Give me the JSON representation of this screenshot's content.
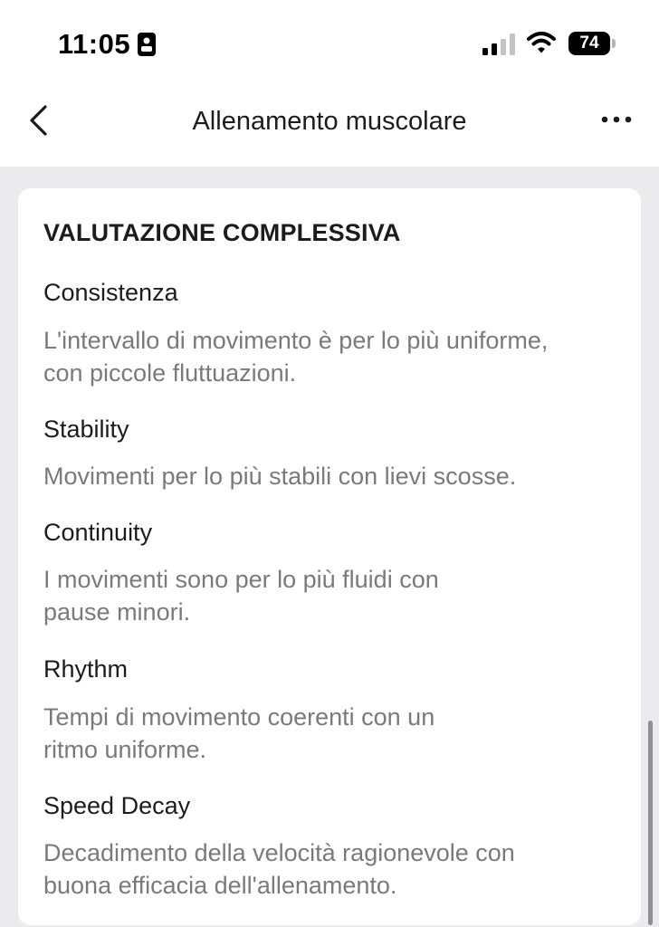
{
  "status_bar": {
    "time": "11:05",
    "battery": "74"
  },
  "nav": {
    "title": "Allenamento muscolare"
  },
  "card": {
    "title": "VALUTAZIONE COMPLESSIVA",
    "items": [
      {
        "heading": "Consistenza",
        "line1": "L'intervallo di movimento è per lo più uniforme,",
        "line2": "con piccole fluttuazioni."
      },
      {
        "heading": "Stability",
        "line1": "Movimenti per lo più stabili con lievi scosse.",
        "line2": ""
      },
      {
        "heading": "Continuity",
        "line1": "I movimenti sono per lo più fluidi con",
        "line2": "pause minori."
      },
      {
        "heading": "Rhythm",
        "line1": "Tempi di movimento coerenti con un",
        "line2": "ritmo uniforme."
      },
      {
        "heading": "Speed Decay",
        "line1": "Decadimento della velocità ragionevole con",
        "line2": "buona efficacia dell'allenamento."
      }
    ]
  }
}
